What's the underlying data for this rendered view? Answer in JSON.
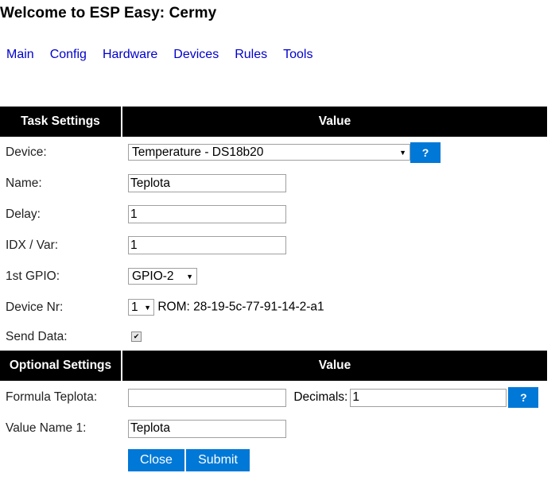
{
  "header": {
    "title": "Welcome to ESP Easy: Cermy"
  },
  "nav": {
    "items": [
      {
        "label": "Main"
      },
      {
        "label": "Config"
      },
      {
        "label": "Hardware"
      },
      {
        "label": "Devices"
      },
      {
        "label": "Rules"
      },
      {
        "label": "Tools"
      }
    ],
    "link_color": "#0000cc"
  },
  "task_section": {
    "header_left": "Task Settings",
    "header_right": "Value",
    "device": {
      "label": "Device:",
      "selected": "Temperature - DS18b20",
      "help": "?"
    },
    "name": {
      "label": "Name:",
      "value": "Teplota"
    },
    "delay": {
      "label": "Delay:",
      "value": "1"
    },
    "idx": {
      "label": "IDX / Var:",
      "value": "1"
    },
    "gpio": {
      "label": "1st GPIO:",
      "selected": "GPIO-2"
    },
    "device_nr": {
      "label": "Device Nr:",
      "selected": "1",
      "rom_text": "ROM: 28-19-5c-77-91-14-2-a1"
    },
    "send_data": {
      "label": "Send Data:",
      "checked": true
    }
  },
  "optional_section": {
    "header_left": "Optional Settings",
    "header_right": "Value",
    "formula": {
      "label": "Formula Teplota:",
      "value": "",
      "decimals_label": "Decimals:",
      "decimals_value": "1",
      "help": "?"
    },
    "value_name": {
      "label": "Value Name 1:",
      "value": "Teplota"
    }
  },
  "actions": {
    "close_label": "Close",
    "submit_label": "Submit"
  },
  "colors": {
    "button_blue": "#0078d7",
    "header_black": "#000000"
  }
}
